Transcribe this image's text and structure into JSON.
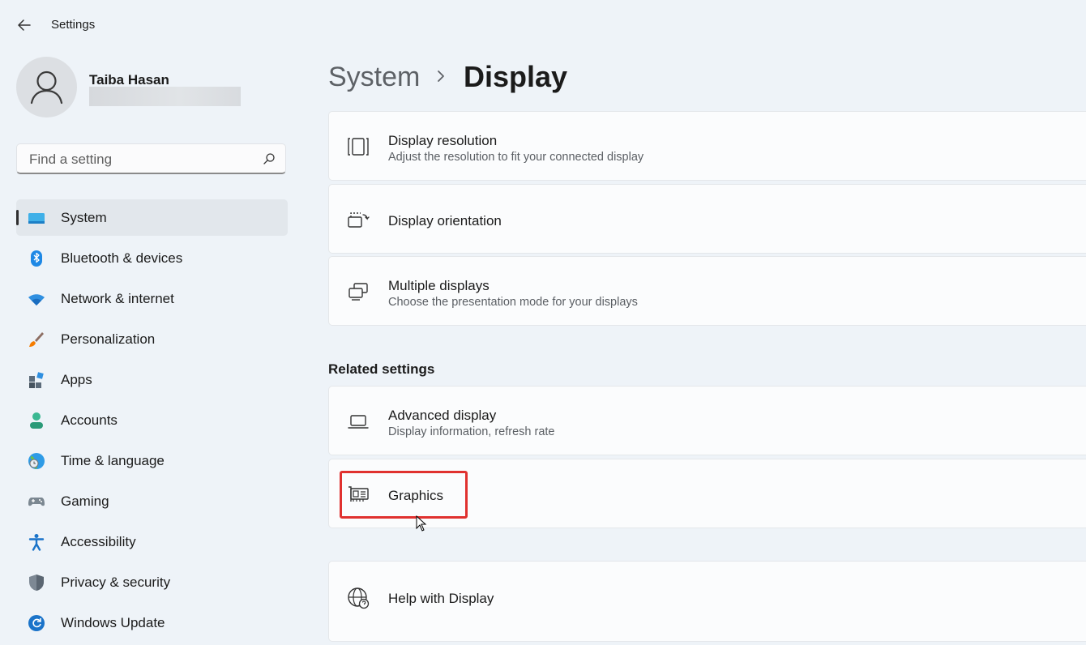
{
  "window": {
    "title": "Settings"
  },
  "profile": {
    "name": "Taiba Hasan"
  },
  "search": {
    "placeholder": "Find a setting"
  },
  "sidebar": {
    "items": [
      {
        "label": "System",
        "active": true
      },
      {
        "label": "Bluetooth & devices"
      },
      {
        "label": "Network & internet"
      },
      {
        "label": "Personalization"
      },
      {
        "label": "Apps"
      },
      {
        "label": "Accounts"
      },
      {
        "label": "Time & language"
      },
      {
        "label": "Gaming"
      },
      {
        "label": "Accessibility"
      },
      {
        "label": "Privacy & security"
      },
      {
        "label": "Windows Update"
      }
    ]
  },
  "breadcrumb": {
    "parent": "System",
    "current": "Display"
  },
  "cards": {
    "resolution": {
      "title": "Display resolution",
      "subtitle": "Adjust the resolution to fit your connected display"
    },
    "orientation": {
      "title": "Display orientation"
    },
    "multiple": {
      "title": "Multiple displays",
      "subtitle": "Choose the presentation mode for your displays"
    }
  },
  "related": {
    "heading": "Related settings",
    "advanced": {
      "title": "Advanced display",
      "subtitle": "Display information, refresh rate"
    },
    "graphics": {
      "title": "Graphics"
    }
  },
  "help": {
    "title": "Help with Display"
  },
  "colors": {
    "accent": "#0067c0",
    "highlight": "#e0312f"
  }
}
